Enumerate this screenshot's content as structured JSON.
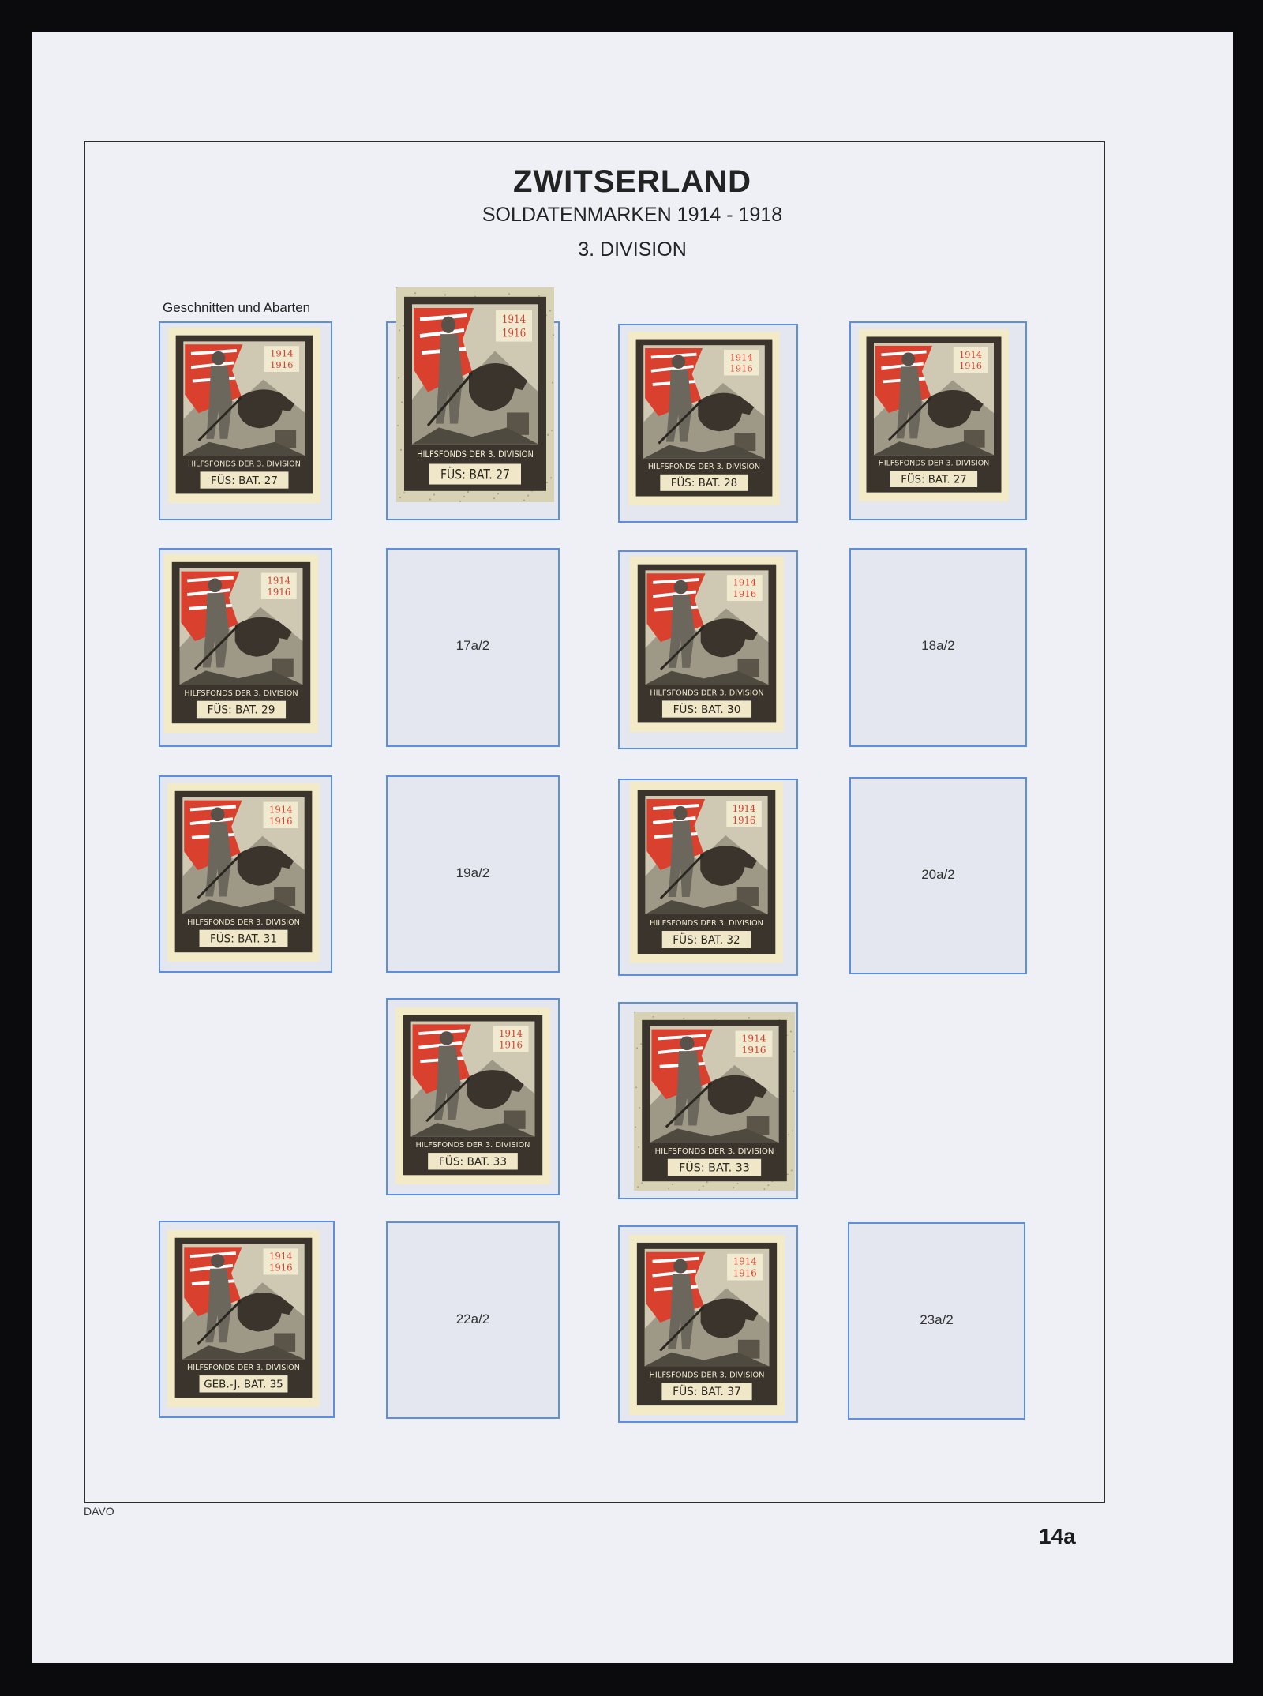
{
  "header": {
    "country": "ZWITSERLAND",
    "subtitle": "SOLDATENMARKEN 1914 - 1918",
    "division": "3. DIVISION"
  },
  "section_label": "Geschnitten und Abarten",
  "stamp_common": {
    "years_top": "1914",
    "years_bottom": "1916",
    "fund_text": "HILFSFONDS DER 3. DIVISION"
  },
  "stamps": [
    {
      "id": "s1",
      "battalion": "FÜS: BAT. 27",
      "paper": "cream"
    },
    {
      "id": "s2",
      "battalion": "FÜS: BAT. 27",
      "paper": "speckled"
    },
    {
      "id": "s3",
      "battalion": "FÜS: BAT. 28",
      "paper": "cream"
    },
    {
      "id": "s4",
      "battalion": "FÜS: BAT. 27",
      "paper": "cream"
    },
    {
      "id": "s5",
      "battalion": "FÜS: BAT. 29",
      "paper": "cream"
    },
    {
      "id": "s6",
      "battalion": "FÜS: BAT. 30",
      "paper": "cream"
    },
    {
      "id": "s7",
      "battalion": "FÜS: BAT. 31",
      "paper": "cream"
    },
    {
      "id": "s8",
      "battalion": "FÜS: BAT. 32",
      "paper": "cream"
    },
    {
      "id": "s9",
      "battalion": "FÜS: BAT. 33",
      "paper": "cream"
    },
    {
      "id": "s10",
      "battalion": "FÜS: BAT. 33",
      "paper": "speckled"
    },
    {
      "id": "s11",
      "battalion": "GEB.-J. BAT. 35",
      "paper": "cream"
    },
    {
      "id": "s12",
      "battalion": "FÜS: BAT. 37",
      "paper": "cream"
    }
  ],
  "empty_slots": [
    {
      "id": "e1",
      "label": "17a/2"
    },
    {
      "id": "e2",
      "label": "18a/2"
    },
    {
      "id": "e3",
      "label": "19a/2"
    },
    {
      "id": "e4",
      "label": "20a/2"
    },
    {
      "id": "e5",
      "label": "22a/2"
    },
    {
      "id": "e6",
      "label": "23a/2"
    }
  ],
  "footer": {
    "brand": "DAVO",
    "page_number": "14a"
  },
  "colors": {
    "slot_border": "#5d8fe0",
    "page_bg": "#eef0f6",
    "stamp_dark": "#3a342c",
    "stamp_red": "#d9402e",
    "stamp_cream": "#f3ebc7"
  }
}
